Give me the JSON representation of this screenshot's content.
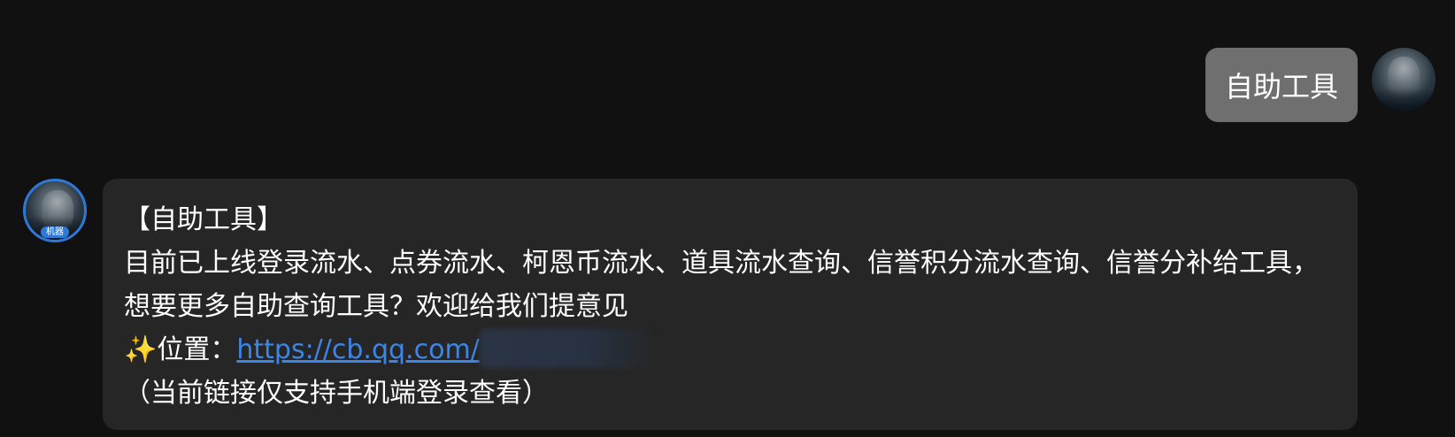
{
  "user_message": {
    "text": "自助工具"
  },
  "bot_message": {
    "title": "【自助工具】",
    "body": "目前已上线登录流水、点券流水、柯恩币流水、道具流水查询、信誉积分流水查询、信誉分补给工具，想要更多自助查询工具？欢迎给我们提意见",
    "sparkle": "✨",
    "location_label": "位置：",
    "link_text": "https://cb.qq.com/",
    "note": "（当前链接仅支持手机端登录查看）"
  },
  "bot_avatar": {
    "badge_text": "机器"
  },
  "colors": {
    "background": "#111111",
    "user_bubble": "#6f6f6f",
    "bot_bubble": "#262626",
    "link": "#3b86e6",
    "avatar_ring": "#2f79d6"
  }
}
